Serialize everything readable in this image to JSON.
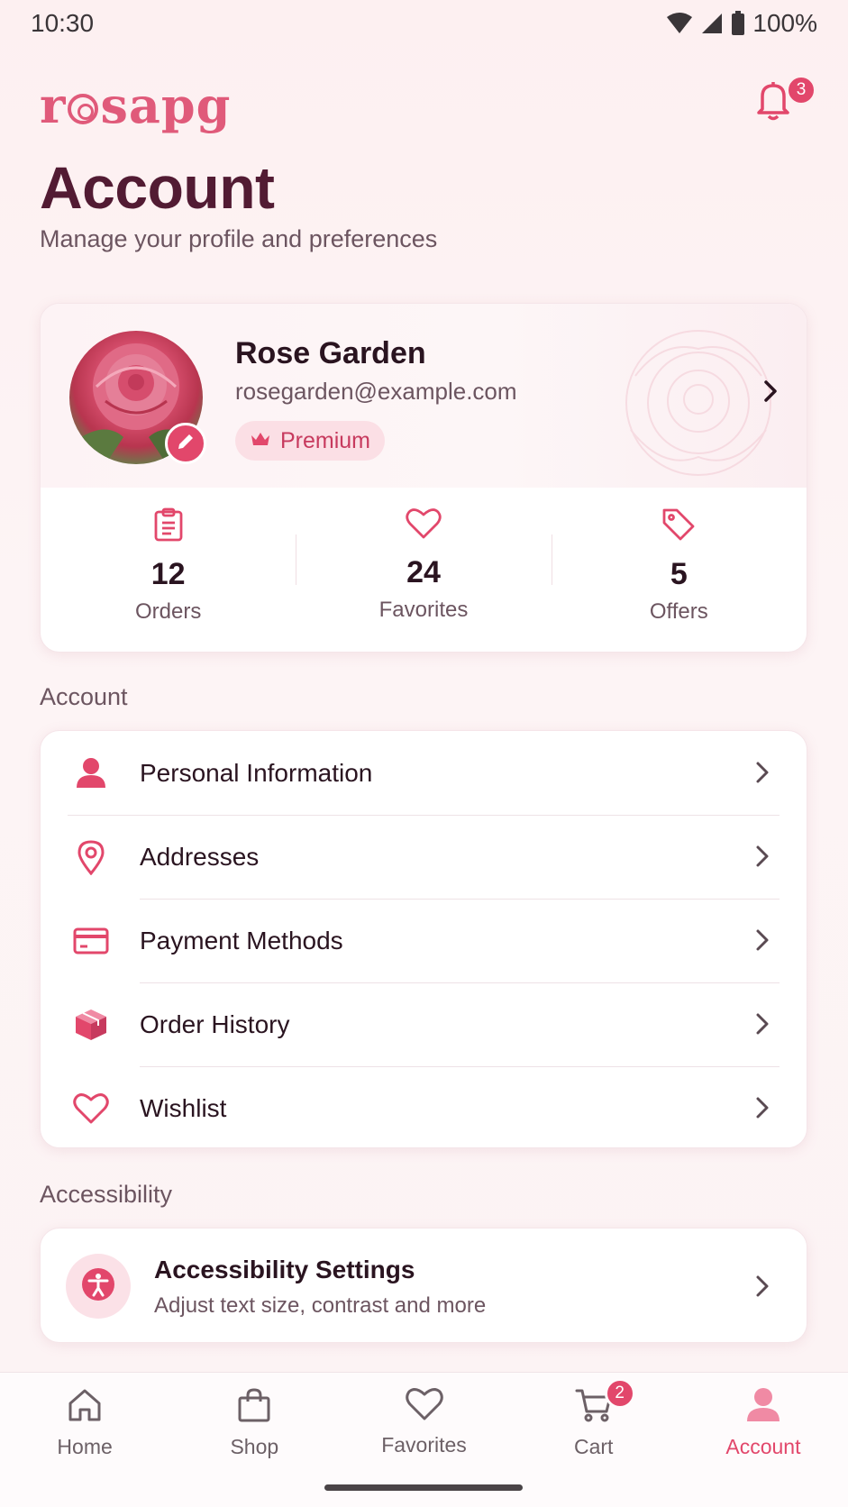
{
  "status_bar": {
    "time": "10:30",
    "battery": "100%"
  },
  "header": {
    "logo": "rosapg",
    "logo_prefix": "r",
    "logo_suffix": "sapg",
    "notification_count": "3"
  },
  "page": {
    "title": "Account",
    "subtitle": "Manage your profile and preferences"
  },
  "profile": {
    "name": "Rose Garden",
    "email": "rosegarden@example.com",
    "badge": "Premium",
    "stats": [
      {
        "value": "12",
        "label": "Orders",
        "icon": "clipboard-icon"
      },
      {
        "value": "24",
        "label": "Favorites",
        "icon": "heart-icon"
      },
      {
        "value": "5",
        "label": "Offers",
        "icon": "tag-icon"
      }
    ]
  },
  "account_section": {
    "title": "Account",
    "items": [
      {
        "label": "Personal Information",
        "icon": "person-icon"
      },
      {
        "label": "Addresses",
        "icon": "location-pin-icon"
      },
      {
        "label": "Payment Methods",
        "icon": "credit-card-icon"
      },
      {
        "label": "Order History",
        "icon": "package-icon"
      },
      {
        "label": "Wishlist",
        "icon": "heart-icon"
      }
    ]
  },
  "accessibility_section": {
    "title": "Accessibility",
    "item": {
      "title": "Accessibility Settings",
      "subtitle": "Adjust text size, contrast and more"
    }
  },
  "bottom_nav": {
    "items": [
      {
        "label": "Home",
        "icon": "home-icon"
      },
      {
        "label": "Shop",
        "icon": "shopping-bag-icon"
      },
      {
        "label": "Favorites",
        "icon": "heart-icon"
      },
      {
        "label": "Cart",
        "icon": "cart-icon",
        "badge": "2"
      },
      {
        "label": "Account",
        "icon": "person-icon",
        "active": true
      }
    ]
  },
  "colors": {
    "accent": "#e2476b",
    "title": "#521b33",
    "background": "#fdf0f1"
  }
}
